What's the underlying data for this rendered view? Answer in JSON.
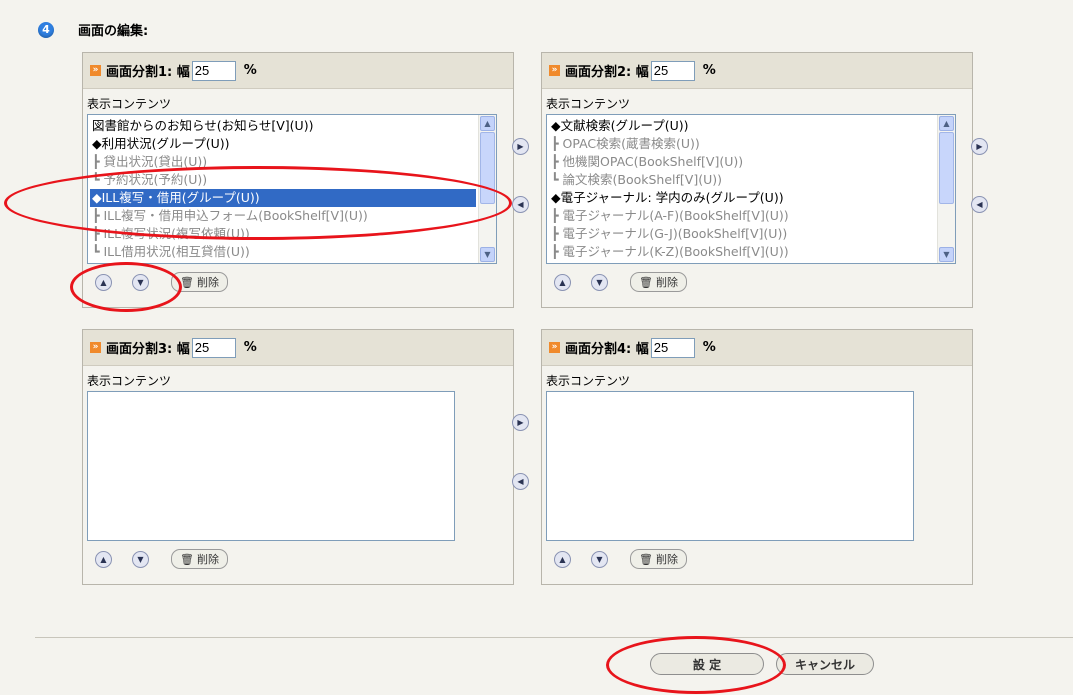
{
  "step": {
    "number": "4",
    "title": "画面の編集:"
  },
  "panels": [
    {
      "title": "画面分割1: 幅",
      "width_value": "25",
      "unit": "%",
      "content_label": "表示コンテンツ",
      "items": [
        {
          "text": "図書館からのお知らせ(お知らせ[V](U))",
          "style": "normal"
        },
        {
          "text": "◆利用状況(グループ(U))",
          "style": "normal"
        },
        {
          "text": "┣ 貸出状況(貸出(U))",
          "style": "child"
        },
        {
          "text": "┗ 予約状況(予約(U))",
          "style": "child"
        },
        {
          "text": "◆ILL複写・借用(グループ(U))",
          "style": "selected"
        },
        {
          "text": "┣ ILL複写・借用申込フォーム(BookShelf[V](U))",
          "style": "child"
        },
        {
          "text": "┣ ILL複写状況(複写依頼(U))",
          "style": "child"
        },
        {
          "text": "┗ ILL借用状況(相互貸借(U))",
          "style": "child"
        }
      ],
      "has_scrollbar": true,
      "delete_label": "削除"
    },
    {
      "title": "画面分割2: 幅",
      "width_value": "25",
      "unit": "%",
      "content_label": "表示コンテンツ",
      "items": [
        {
          "text": "◆文献検索(グループ(U))",
          "style": "normal"
        },
        {
          "text": "┣ OPAC検索(蔵書検索(U))",
          "style": "child"
        },
        {
          "text": "┣ 他機関OPAC(BookShelf[V](U))",
          "style": "child"
        },
        {
          "text": "┗ 論文検索(BookShelf[V](U))",
          "style": "child"
        },
        {
          "text": "◆電子ジャーナル: 学内のみ(グループ(U))",
          "style": "normal"
        },
        {
          "text": "┣ 電子ジャーナル(A-F)(BookShelf[V](U))",
          "style": "child"
        },
        {
          "text": "┣ 電子ジャーナル(G-J)(BookShelf[V](U))",
          "style": "child"
        },
        {
          "text": "┣ 電子ジャーナル(K-Z)(BookShelf[V](U))",
          "style": "child"
        }
      ],
      "has_scrollbar": true,
      "delete_label": "削除"
    },
    {
      "title": "画面分割3: 幅",
      "width_value": "25",
      "unit": "%",
      "content_label": "表示コンテンツ",
      "items": [],
      "has_scrollbar": false,
      "delete_label": "削除"
    },
    {
      "title": "画面分割4: 幅",
      "width_value": "25",
      "unit": "%",
      "content_label": "表示コンテンツ",
      "items": [],
      "has_scrollbar": false,
      "delete_label": "削除"
    }
  ],
  "buttons": {
    "submit": "設 定",
    "cancel": "キャンセル"
  },
  "icons": {
    "move_up": "▲",
    "move_down": "▼",
    "move_right": "▶",
    "move_left": "◀",
    "delete": "trash-icon",
    "header": "double-chevron-icon",
    "step": "number-circle-icon"
  },
  "colors": {
    "background": "#f4f3ee",
    "panel_header": "#e5e2d6",
    "selection": "#316ac5",
    "annotation": "#e8141b",
    "header_icon": "#f08a2c",
    "step_badge": "#2f7fe0"
  }
}
